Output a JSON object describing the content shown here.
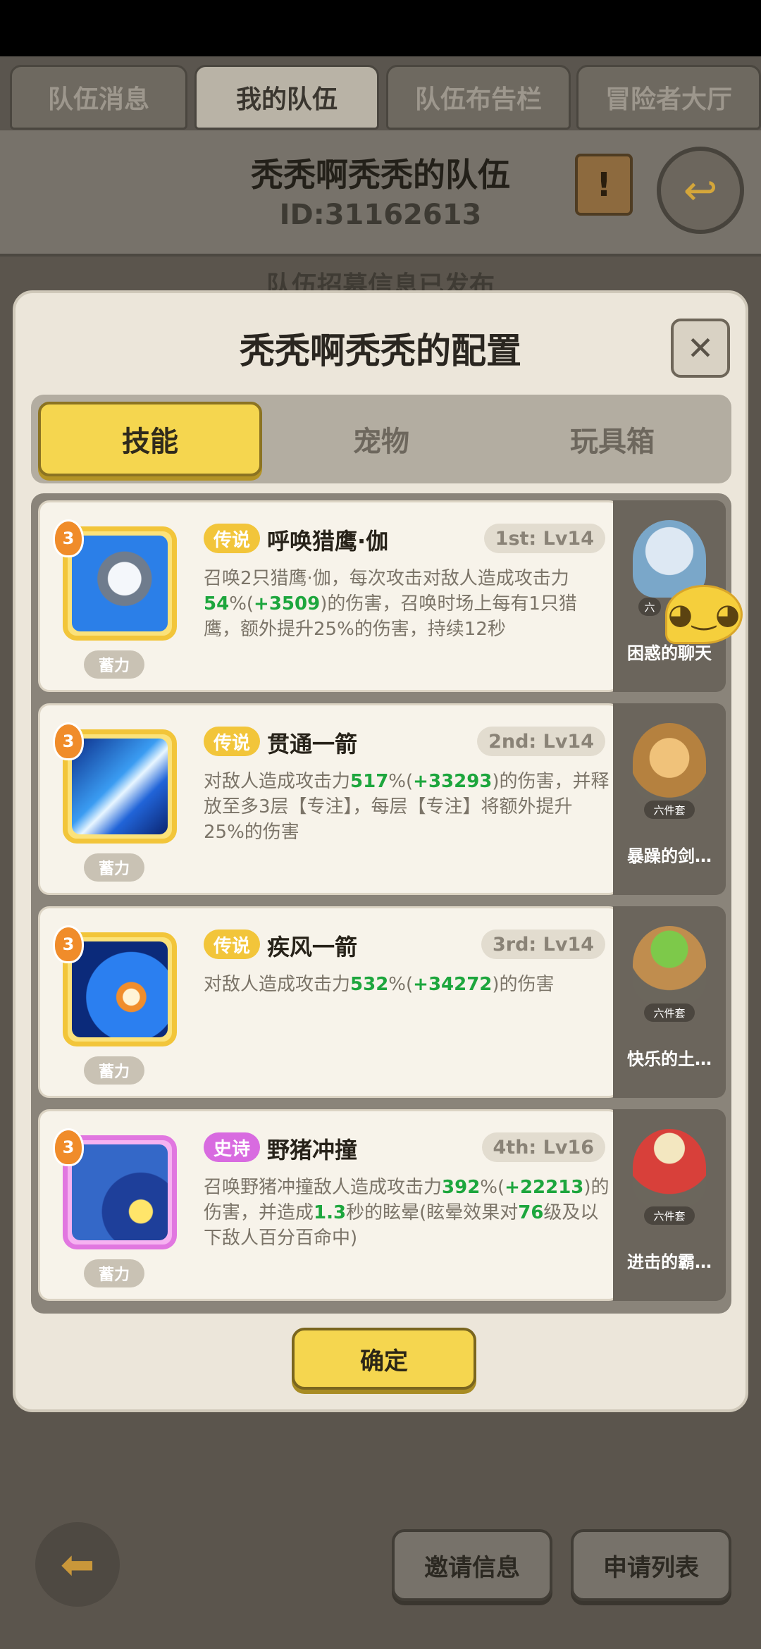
{
  "top_tabs": [
    "队伍消息",
    "我的队伍",
    "队伍布告栏",
    "冒险者大厅"
  ],
  "team": {
    "name": "秃秃啊秃秃的队伍",
    "id": "ID:31162613"
  },
  "behind_text": "队伍招募信息已发布",
  "modal": {
    "title": "秃秃啊秃秃的配置",
    "close_glyph": "✕",
    "tabs": [
      "技能",
      "宠物",
      "玩具箱"
    ],
    "skills": [
      {
        "level": "3",
        "charge": "蓄力",
        "rarity": "传说",
        "name": "呼唤猎鹰·伽",
        "slot": "1st: Lv14",
        "desc_parts": [
          {
            "t": "召唤2只猎鹰·伽，每次攻击对敌人造成攻击力"
          },
          {
            "t": "54",
            "hl": true
          },
          {
            "t": "%("
          },
          {
            "t": "+3509",
            "hl": true
          },
          {
            "t": ")的伤害，召唤时场上每有1只猎鹰，额外提升25%的伤害，持续12秒"
          }
        ]
      },
      {
        "level": "3",
        "charge": "蓄力",
        "rarity": "传说",
        "name": "贯通一箭",
        "slot": "2nd: Lv14",
        "desc_parts": [
          {
            "t": "对敌人造成攻击力"
          },
          {
            "t": "517",
            "hl": true
          },
          {
            "t": "%("
          },
          {
            "t": "+33293",
            "hl": true
          },
          {
            "t": ")的伤害，并释放至多3层【专注】，每层【专注】将额外提升25%的伤害"
          }
        ]
      },
      {
        "level": "3",
        "charge": "蓄力",
        "rarity": "传说",
        "name": "疾风一箭",
        "slot": "3rd: Lv14",
        "desc_parts": [
          {
            "t": "对敌人造成攻击力"
          },
          {
            "t": "532",
            "hl": true
          },
          {
            "t": "%("
          },
          {
            "t": "+34272",
            "hl": true
          },
          {
            "t": ")的伤害"
          }
        ]
      },
      {
        "level": "3",
        "charge": "蓄力",
        "rarity": "史诗",
        "name": "野猪冲撞",
        "slot": "4th: Lv16",
        "desc_parts": [
          {
            "t": "召唤野猪冲撞敌人造成攻击力"
          },
          {
            "t": "392",
            "hl": true
          },
          {
            "t": "%("
          },
          {
            "t": "+22213",
            "hl": true
          },
          {
            "t": ")的伤害，并造成"
          },
          {
            "t": "1.3",
            "hl": true
          },
          {
            "t": "秒的眩晕(眩晕效果对"
          },
          {
            "t": "76",
            "hl": true
          },
          {
            "t": "级及以下敌人百分百命中)"
          }
        ]
      }
    ],
    "sets": [
      {
        "label": "困惑的聊天",
        "badge": "六"
      },
      {
        "label": "暴躁的剑…",
        "badge": "六件套"
      },
      {
        "label": "快乐的土…",
        "badge": "六件套"
      },
      {
        "label": "进击的霸…",
        "badge": "六件套"
      }
    ],
    "confirm": "确定"
  },
  "bottom": {
    "invite": "邀请信息",
    "apply": "申请列表"
  },
  "colors": {
    "accent": "#f5d64f",
    "highlight": "#1da63d",
    "legend": "#f2c53a",
    "epic": "#d86be0"
  }
}
